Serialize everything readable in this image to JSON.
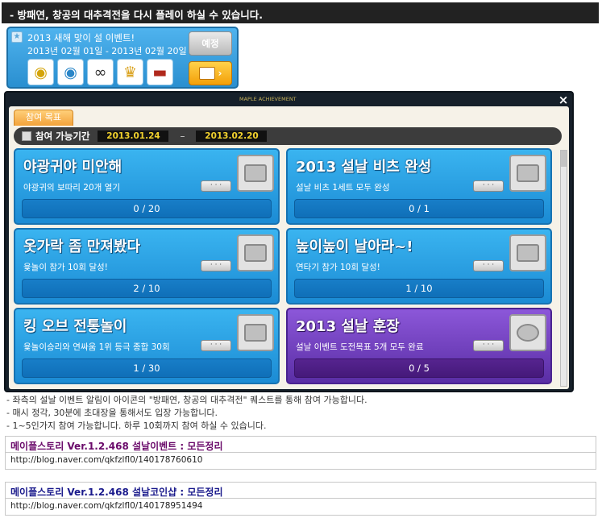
{
  "header": {
    "title": "- 방패연, 창공의 대추격전을 다시 플레이 하실 수 있습니다."
  },
  "event": {
    "title": "2013 새해 맞이 설 이벤트!",
    "date_range": "2013년 02월 01일 - 2013년 02월 20일",
    "button_label": "예정",
    "items": [
      "coin-icon",
      "blue-coin-icon",
      "glasses-icon",
      "trophy-icon",
      "hat-icon"
    ]
  },
  "achievement": {
    "header": "MAPLE ACHIEVEMENT",
    "tab_label": "참여 목표",
    "period_label": "참여 가능기간",
    "start_date": "2013.01.24",
    "end_date": "2013.02.20",
    "more_label": "· · ·",
    "cards": [
      {
        "title": "야광귀야 미안해",
        "desc": "야광귀의 보따리 20개 열기",
        "progress": "0 / 20",
        "color": "#2196d9"
      },
      {
        "title": "2013 설날 비츠 완성",
        "desc": "설날 비츠 1세트 모두 완성",
        "progress": "0 / 1",
        "color": "#2196d9"
      },
      {
        "title": "옷가락 좀 만져봤다",
        "desc": "윷놀이 참가 10회 달성!",
        "progress": "2 / 10",
        "color": "#2196d9"
      },
      {
        "title": "높이높이 날아라~!",
        "desc": "연타기 참가 10회 달성!",
        "progress": "1 / 10",
        "color": "#2196d9"
      },
      {
        "title": "킹 오브 전통놀이",
        "desc": "윷놀이승리와 연싸움 1위 등극 종합 30회",
        "progress": "1 / 30",
        "color": "#2196d9"
      },
      {
        "title": "2013 설날 훈장",
        "desc": "설날 이벤트 도전목표 5개 모두 완료",
        "progress": "0 / 5",
        "color": "#6b3cc1"
      }
    ]
  },
  "notes": [
    "- 좌측의 설날 이벤트 알림이 아이콘의 \"방패연, 창공의 대추격전\" 퀘스트를 통해 참여 가능합니다.",
    "- 매시 정각, 30분에 초대장을 통해서도 입장 가능합니다.",
    "- 1~5인가지 참여 가능합니다. 하루 10회까지 참여 하실 수 있습니다."
  ],
  "links": [
    {
      "title": "메이플스토리 Ver.1.2.468 설날이벤트 : 모든정리",
      "url": "http://blog.naver.com/qkfzlfl0/140178760610"
    },
    {
      "title": "메이플스토리 Ver.1.2.468 설날코인샵 : 모든정리",
      "url": "http://blog.naver.com/qkfzlfl0/140178951494"
    }
  ]
}
